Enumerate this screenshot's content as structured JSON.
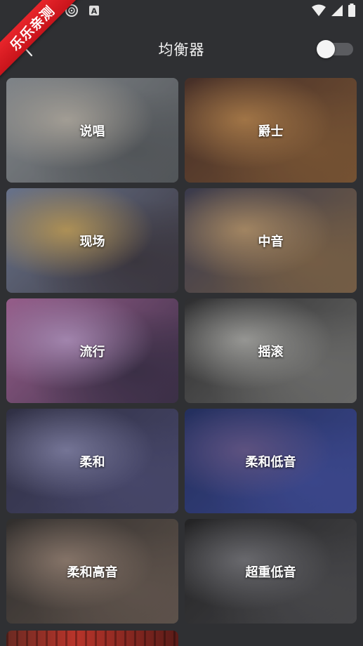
{
  "ribbon": {
    "text": "乐乐亲测"
  },
  "header": {
    "title": "均衡器",
    "toggle_on": false
  },
  "presets": [
    {
      "label": "说唱",
      "colors": [
        "#9aa0a6",
        "#5a5f64",
        "#c9c2b6"
      ]
    },
    {
      "label": "爵士",
      "colors": [
        "#4a2a20",
        "#8a5a30",
        "#c78a4a"
      ]
    },
    {
      "label": "现场",
      "colors": [
        "#7a88a8",
        "#3a3440",
        "#d8b060"
      ]
    },
    {
      "label": "中音",
      "colors": [
        "#3a3a52",
        "#8a6a48",
        "#c8a070"
      ]
    },
    {
      "label": "流行",
      "colors": [
        "#b86aa8",
        "#3a2a4a",
        "#c8a0d8"
      ]
    },
    {
      "label": "摇滚",
      "colors": [
        "#2a2a2c",
        "#7a7a78",
        "#b8b8b4"
      ]
    },
    {
      "label": "柔和",
      "colors": [
        "#2c2c48",
        "#4a4a7a",
        "#8a8ab8"
      ]
    },
    {
      "label": "柔和低音",
      "colors": [
        "#1a2a6a",
        "#3a4aa8",
        "#6a5a9a"
      ]
    },
    {
      "label": "柔和高音",
      "colors": [
        "#2e2a28",
        "#6a5a50",
        "#a08878"
      ]
    },
    {
      "label": "超重低音",
      "colors": [
        "#1a1a1c",
        "#4a4a4e",
        "#7a7a80"
      ]
    }
  ]
}
